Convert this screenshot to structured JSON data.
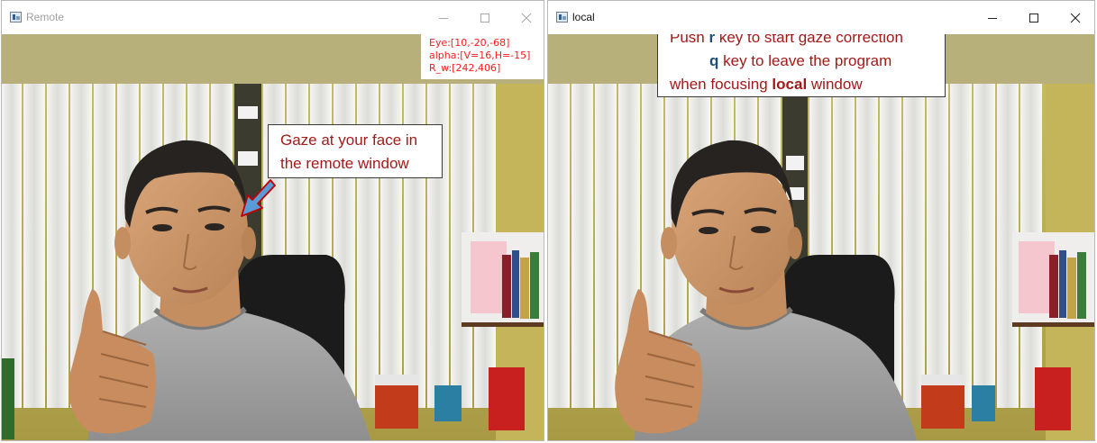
{
  "remote_window": {
    "title": "Remote",
    "icon": "opencv-window-icon",
    "overlay": {
      "eye": "Eye:[10,-20,-68]",
      "alpha": "alpha:[V=16,H=-15]",
      "r_w": "R_w:[242,406]"
    }
  },
  "local_window": {
    "title": "local",
    "icon": "opencv-window-icon"
  },
  "annotations": {
    "gaze_line1": "Gaze at your face in",
    "gaze_line2": "the remote window",
    "instr_push": "Push",
    "instr_r": "r",
    "instr_r_rest": "key to start gaze correction",
    "instr_q": "q",
    "instr_q_rest": "key to leave the program",
    "instr_when": "when focusing",
    "instr_local": "local",
    "instr_window": "window"
  },
  "colors": {
    "annotation_text": "#a11a1a",
    "key_text": "#1f4e79",
    "overlay_text": "#ff1a1a",
    "arrow_fill": "#5b9bd5",
    "arrow_outline": "#c00000"
  }
}
